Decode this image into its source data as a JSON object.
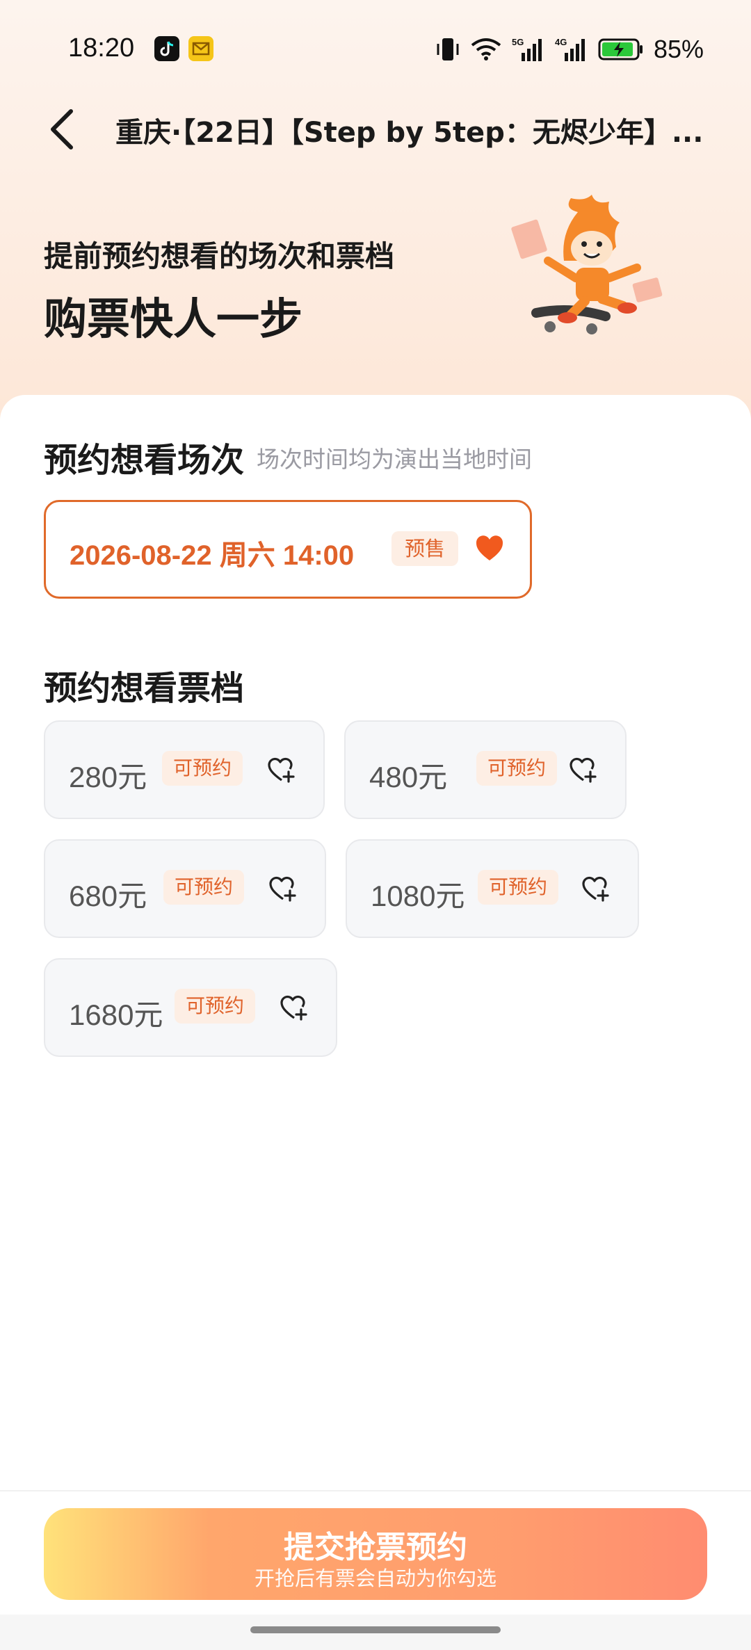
{
  "status_bar": {
    "time": "18:20",
    "battery": "85%",
    "icons": [
      "tiktok-icon",
      "mail-icon",
      "vibrate-icon",
      "wifi-icon",
      "5g-signal-icon",
      "4g-signal-icon",
      "battery-icon"
    ]
  },
  "nav": {
    "title": "重庆·【22日】【Step by 5tep：无烬少年】..."
  },
  "hero": {
    "subtitle": "提前预约想看的场次和票档",
    "title": "购票快人一步"
  },
  "sessions": {
    "title": "预约想看场次",
    "note": "场次时间均为演出当地时间",
    "items": [
      {
        "datetime": "2026-08-22 周六 14:00",
        "tag": "预售",
        "selected": true
      }
    ]
  },
  "tiers": {
    "title": "预约想看票档",
    "items": [
      {
        "price": "280元",
        "tag": "可预约"
      },
      {
        "price": "480元",
        "tag": "可预约"
      },
      {
        "price": "680元",
        "tag": "可预约"
      },
      {
        "price": "1080元",
        "tag": "可预约"
      },
      {
        "price": "1680元",
        "tag": "可预约"
      }
    ]
  },
  "submit": {
    "label": "提交抢票预约",
    "sub": "开抢后有票会自动为你勾选"
  },
  "colors": {
    "accent": "#e0622a",
    "heart": "#f15a1e",
    "tag_bg": "#fdeee4"
  }
}
